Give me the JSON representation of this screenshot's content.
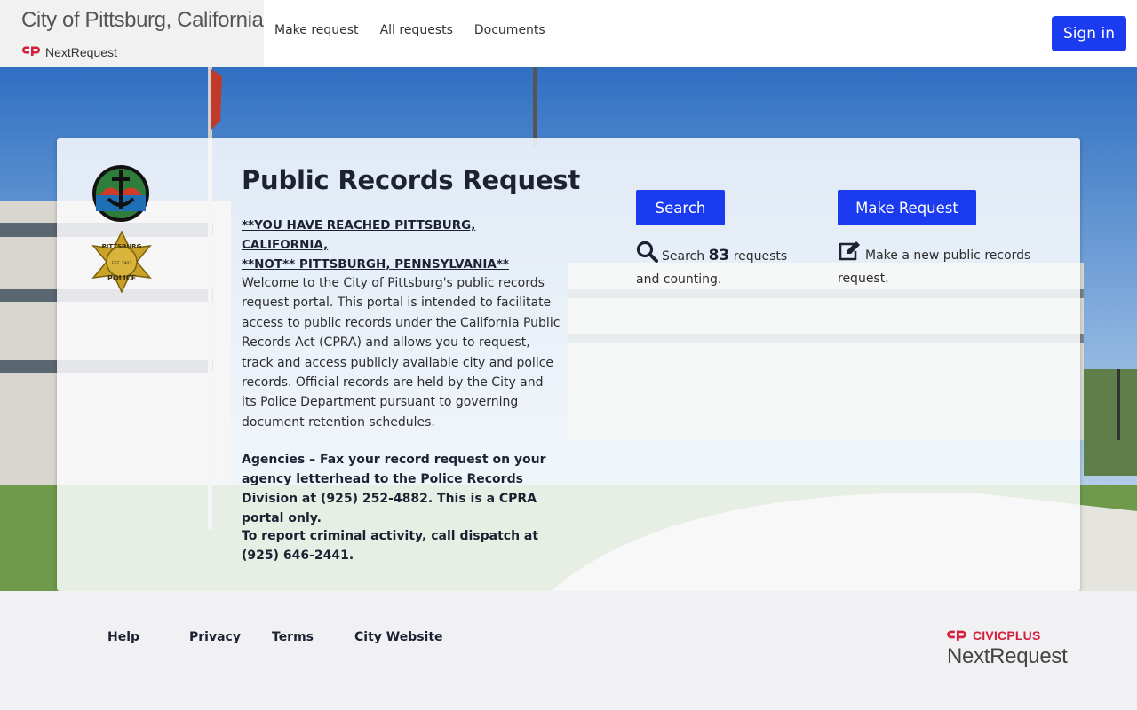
{
  "header": {
    "city_title": "City of Pittsburg, California",
    "product_name": "NextRequest",
    "nav": [
      "Make request",
      "All requests",
      "Documents"
    ],
    "sign_in_label": "Sign in"
  },
  "hero": {
    "title": "Public Records Request",
    "notice_line1": "**YOU HAVE REACHED PITTSBURG, CALIFORNIA,",
    "notice_line2": "**NOT** PITTSBURGH, PENNSYLVANIA**",
    "welcome": "Welcome to the City of Pittsburg's public records request portal. This portal is intended to facilitate access to public records under the California Public Records Act (CPRA) and allows you to request, track and access publicly available city and police records. Official records are held by the City and its Police Department pursuant to governing document retention schedules.",
    "agencies": "Agencies – Fax your record request on your agency letterhead to the Police Records Division at (925) 252-4882. This is a CPRA portal only.",
    "dispatch": "To report criminal activity, call dispatch at (925) 646-2441.",
    "police_badge_top": "PITTSBURG",
    "police_badge_bottom": "POLICE",
    "police_badge_est": "EST. 1903"
  },
  "actions": {
    "search_button": "Search",
    "search_prefix": "Search",
    "search_count": "83",
    "search_suffix": "requests and counting.",
    "make_button": "Make Request",
    "make_text": "Make a new public records request."
  },
  "footer": {
    "links": [
      "Help",
      "Privacy",
      "Terms",
      "City Website"
    ],
    "civicplus": "CIVICPLUS",
    "nextrequest": "NextRequest"
  },
  "icons": {
    "search": "search-icon",
    "edit": "edit-icon",
    "brand_mark": "nextrequest-mark-icon"
  },
  "colors": {
    "primary": "#1b3bf0",
    "brand_red": "#d21f3a",
    "heading": "#1d2233"
  }
}
